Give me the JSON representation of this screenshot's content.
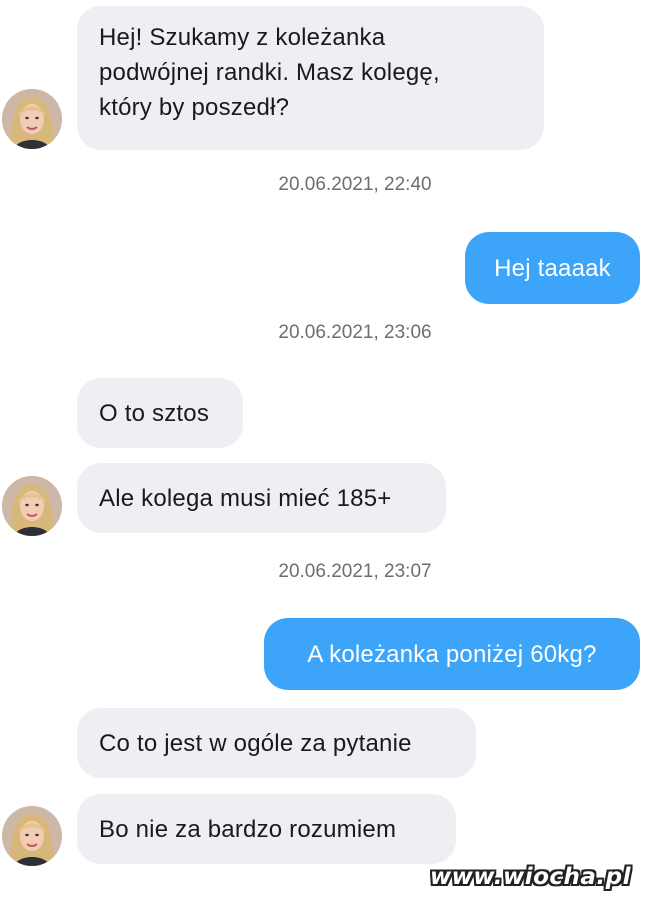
{
  "conversation": {
    "messages": [
      {
        "lines": [
          "Hej! Szukamy z koleżanka",
          "podwójnej randki. Masz kolegę,",
          "który by poszedł?"
        ]
      },
      {
        "timestamp": "20.06.2021, 22:40"
      },
      {
        "text": "Hej taaaak"
      },
      {
        "timestamp": "20.06.2021, 23:06"
      },
      {
        "text": "O to sztos"
      },
      {
        "text": "Ale kolega musi mieć 185+"
      },
      {
        "timestamp": "20.06.2021, 23:07"
      },
      {
        "text": "A koleżanka poniżej 60kg?"
      },
      {
        "text": "Co to jest w ogóle za pytanie"
      },
      {
        "text": "Bo nie za bardzo rozumiem"
      }
    ]
  },
  "watermark": "www.wiocha.pl",
  "colors": {
    "incoming_bubble": "#efeef3",
    "outgoing_bubble": "#3da5f9",
    "timestamp_text": "#6e6e6e"
  },
  "icons": {
    "avatar": "contact-avatar-photo"
  }
}
